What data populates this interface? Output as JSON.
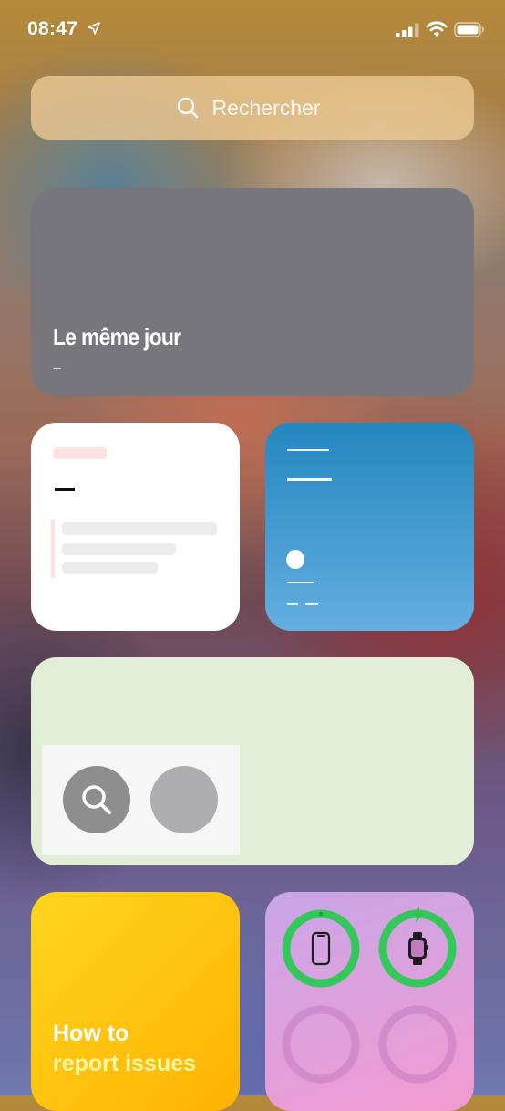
{
  "status_bar": {
    "time": "08:47",
    "signal_bars_active": 3,
    "signal_bars_total": 4
  },
  "search": {
    "placeholder": "Rechercher",
    "icon": "search-icon"
  },
  "widgets": {
    "memories": {
      "title": "Le même jour",
      "subtitle": "--"
    },
    "calendar": {
      "state": "placeholder"
    },
    "weather": {
      "state": "placeholder"
    },
    "siri_suggestions": {
      "icons": [
        "search-icon",
        "app-placeholder"
      ]
    },
    "tips": {
      "line1": "How to",
      "line2": "report issues"
    },
    "batteries": {
      "devices": [
        {
          "name": "iPhone",
          "icon": "iphone-icon",
          "color": "#34c759"
        },
        {
          "name": "Apple Watch",
          "icon": "watch-icon",
          "color": "#34c759",
          "charging": true
        }
      ]
    }
  },
  "colors": {
    "memories_bg": "#77767d",
    "weather_top": "#2487bf",
    "suggestions_bg": "#e1edd5",
    "tips_yellow": "#ffc20e",
    "battery_green": "#34c759"
  }
}
